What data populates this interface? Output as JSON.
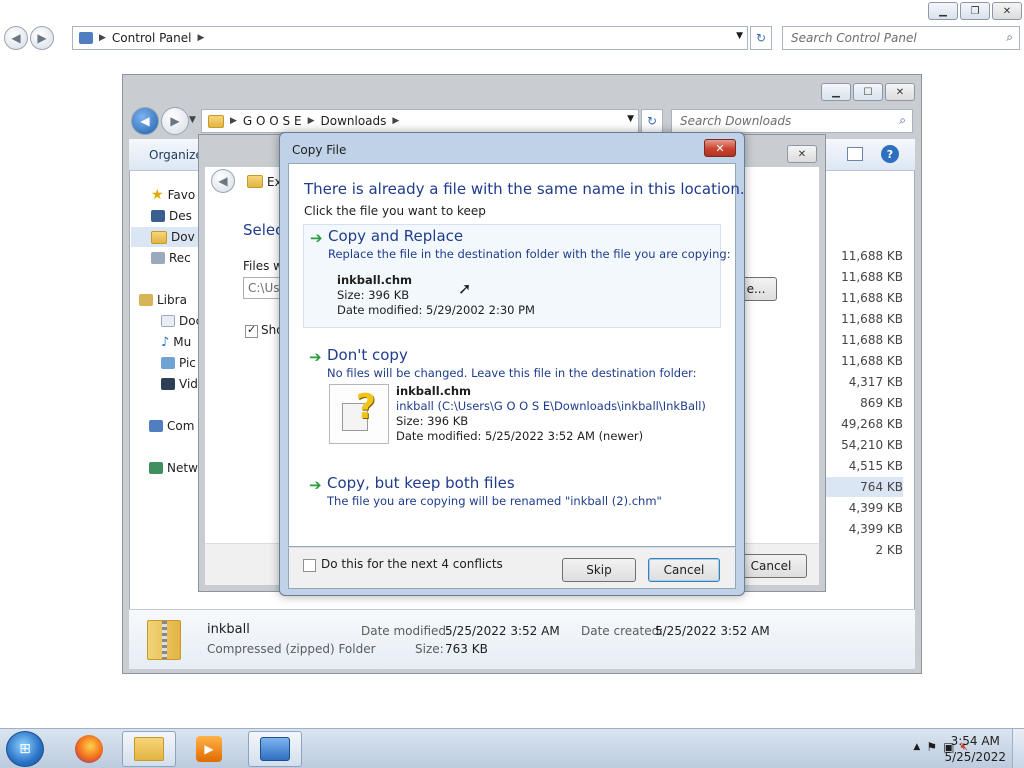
{
  "control_panel": {
    "address": "Control Panel",
    "search_placeholder": "Search Control Panel"
  },
  "downloads": {
    "breadcrumb": [
      "G O O S E",
      "Downloads"
    ],
    "search_placeholder": "Search Downloads",
    "toolbar_organize": "Organize",
    "nav": [
      {
        "label": "Favo",
        "icon": "star-icon"
      },
      {
        "label": "Des",
        "icon": "desktop-icon"
      },
      {
        "label": "Dov",
        "icon": "downloads-folder-icon"
      },
      {
        "label": "Rec",
        "icon": "recent-places-icon"
      },
      {
        "label": "Libra",
        "icon": "libraries-icon"
      },
      {
        "label": "Doc",
        "icon": "documents-icon"
      },
      {
        "label": "Mu",
        "icon": "music-icon"
      },
      {
        "label": "Pic",
        "icon": "pictures-icon"
      },
      {
        "label": "Vid",
        "icon": "videos-icon"
      },
      {
        "label": "Com",
        "icon": "computer-icon"
      },
      {
        "label": "Netw",
        "icon": "network-icon"
      }
    ],
    "sizes": [
      "11,688 KB",
      "11,688 KB",
      "11,688 KB",
      "11,688 KB",
      "11,688 KB",
      "11,688 KB",
      "4,317 KB",
      "869 KB",
      "49,268 KB",
      "54,210 KB",
      "4,515 KB",
      "764 KB",
      "4,399 KB",
      "4,399 KB",
      "2 KB"
    ],
    "details": {
      "name": "inkball",
      "type": "Compressed (zipped) Folder",
      "modified_label": "Date modified:",
      "modified": "5/25/2022 3:52 AM",
      "created_label": "Date created:",
      "created": "5/25/2022 3:52 AM",
      "size_label": "Size:",
      "size": "763 KB"
    }
  },
  "extract": {
    "header_fragment": "Ext",
    "select_fragment": "Selec",
    "files_fragment": "Files w",
    "path_fragment": "C:\\Us",
    "browse_fragment": "e...",
    "show_fragment": "Sho",
    "cancel_label": "Cancel"
  },
  "copy_file": {
    "title": "Copy File",
    "heading": "There is already a file with the same name in this location.",
    "subheading": "Click the file you want to keep",
    "replace": {
      "title": "Copy and Replace",
      "desc": "Replace the file in the destination folder with the file you are copying:",
      "filename": "inkball.chm",
      "size": "Size: 396 KB",
      "modified": "Date modified: 5/29/2002 2:30 PM"
    },
    "dont_copy": {
      "title": "Don't copy",
      "desc": "No files will be changed. Leave this file in the destination folder:",
      "filename": "inkball.chm",
      "path": "inkball (C:\\Users\\G O O S E\\Downloads\\inkball\\InkBall)",
      "size": "Size: 396 KB",
      "modified": "Date modified: 5/25/2022 3:52 AM (newer)"
    },
    "keep_both": {
      "title": "Copy, but keep both files",
      "desc": "The file you are copying will be renamed \"inkball (2).chm\""
    },
    "checkbox_label": "Do this for the next 4 conflicts",
    "skip_label": "Skip",
    "cancel_label": "Cancel"
  },
  "taskbar": {
    "time": "3:54 AM",
    "date": "5/25/2022"
  },
  "colors": {
    "heading_blue": "#1f3c8c",
    "arrow_green": "#2e9a3e",
    "close_red": "#c9432f"
  }
}
